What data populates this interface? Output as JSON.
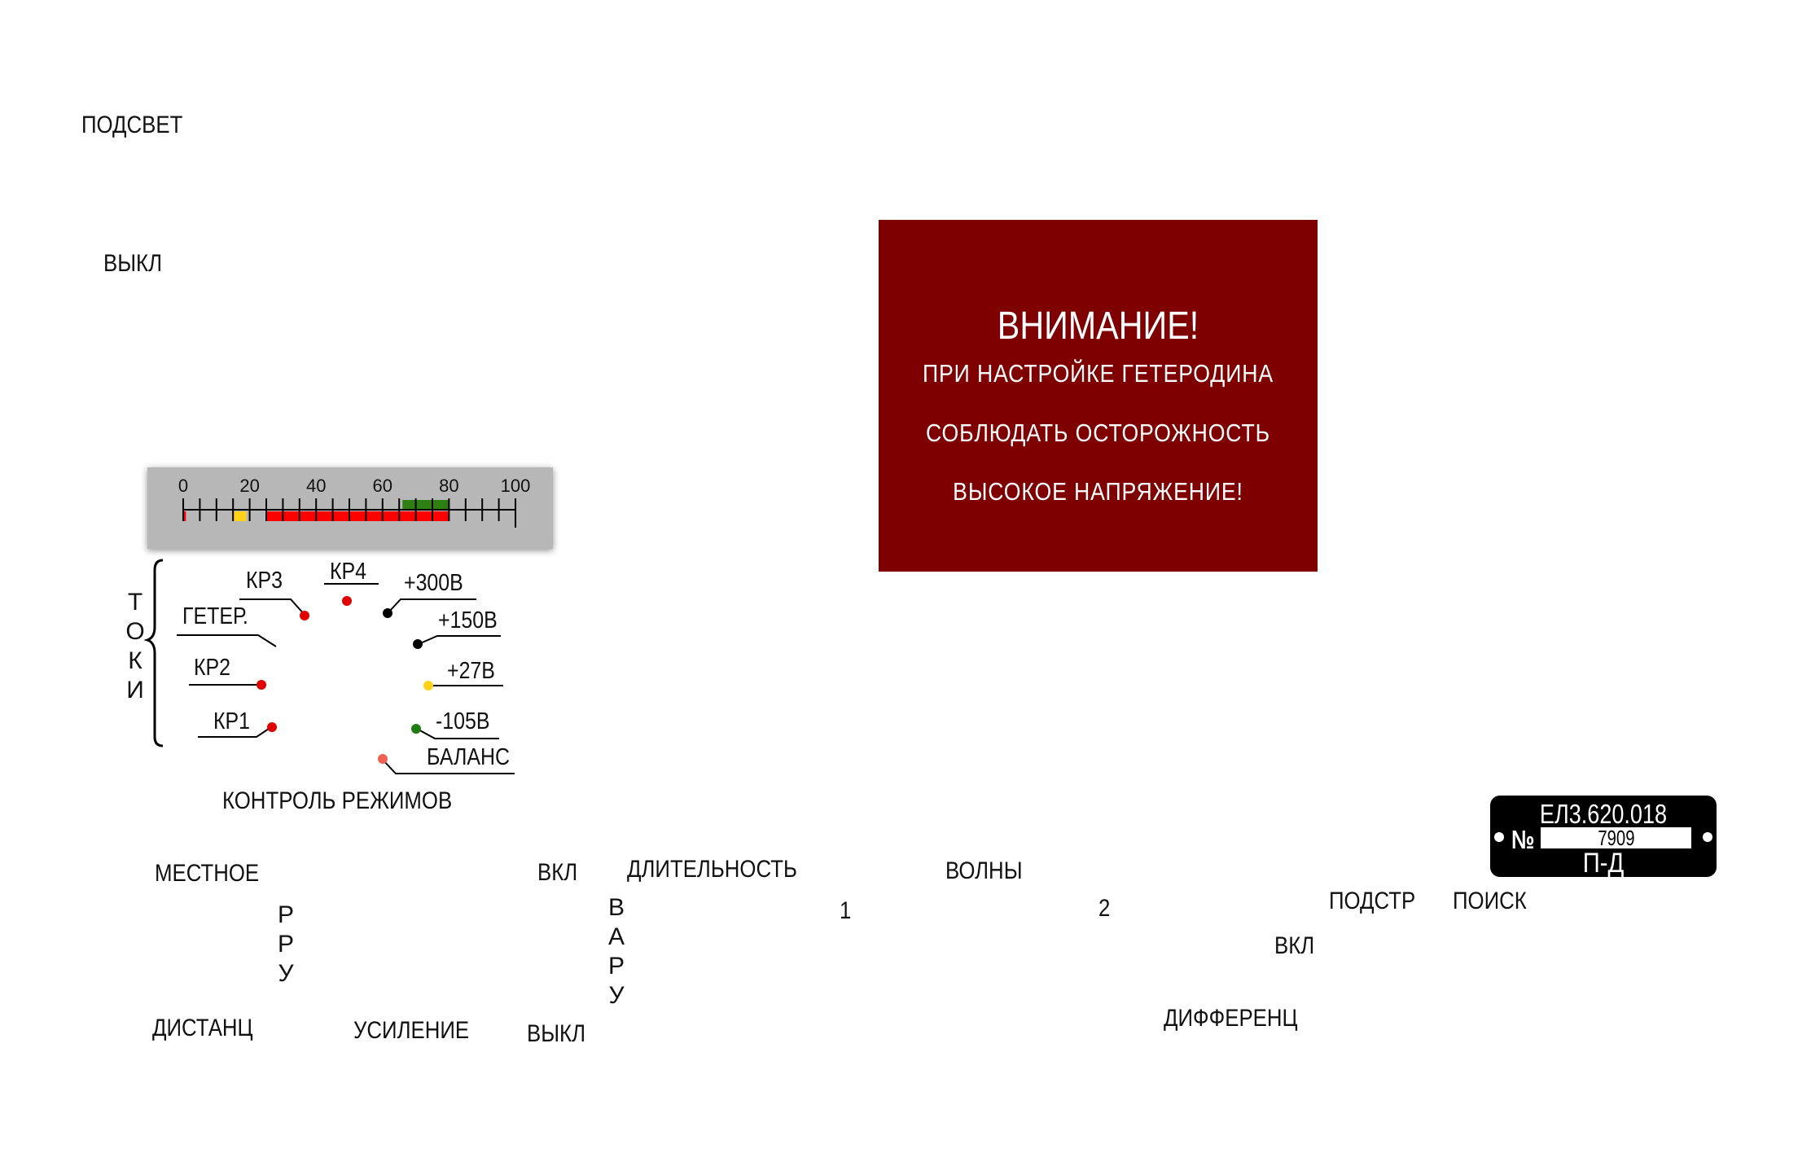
{
  "backlight": {
    "title": "ПОДСВЕТ",
    "off": "ВЫКЛ"
  },
  "warning": {
    "title": "ВНИМАНИЕ!",
    "line1": "ПРИ  НАСТРОЙКЕ  ГЕТЕРОДИНА",
    "line2": "СОБЛЮДАТЬ  ОСТОРОЖНОСТЬ",
    "line3": "ВЫСОКОЕ  НАПРЯЖЕНИЕ!",
    "color": "#7f0000"
  },
  "meter": {
    "scale_labels": [
      "0",
      "20",
      "40",
      "60",
      "80",
      "100"
    ],
    "scale_min": 0,
    "scale_max": 100,
    "zones": [
      {
        "from": 0,
        "to": 0.8,
        "color": "#ff0000",
        "row": "lower"
      },
      {
        "from": 15,
        "to": 19,
        "color": "#ffd21a",
        "row": "lower"
      },
      {
        "from": 25,
        "to": 80,
        "color": "#ff0000",
        "row": "lower"
      },
      {
        "from": 66,
        "to": 80,
        "color": "#2d7f12",
        "row": "upper"
      }
    ]
  },
  "control": {
    "currents_label": "ТОКИ",
    "items": {
      "kr3": "КР3",
      "kr4": "КР4",
      "v300": "+300В",
      "geter": "ГЕТЕР.",
      "v150": "+150В",
      "kr2": "КР2",
      "v27": "+27В",
      "kr1": "КР1",
      "v105": "-105В",
      "balance": "БАЛАНС"
    },
    "dot_colors": {
      "red": "#e00000",
      "black": "#000000",
      "yellow": "#ffd21a",
      "green": "#1f7a10",
      "salmon": "#f06050"
    },
    "footer": "КОНТРОЛЬ  РЕЖИМОВ"
  },
  "controls": {
    "local": "МЕСТНОЕ",
    "rru": "РРУ",
    "remote": "ДИСТАНЦ",
    "gain": "УСИЛЕНИЕ",
    "vkl1": "ВКЛ",
    "vykl1": "ВЫКЛ",
    "varu": "ВАРУ",
    "duration": "ДЛИТЕЛЬНОСТЬ",
    "waves": "ВОЛНЫ",
    "pos1": "1",
    "pos2": "2",
    "tune": "ПОДСТР",
    "search": "ПОИСК",
    "vkl2": "ВКЛ",
    "diff": "ДИФФЕРЕНЦ"
  },
  "plate": {
    "code": "ЕЛ3.620.018",
    "no_label": "№",
    "serial": "7909",
    "type": "П-Д"
  }
}
